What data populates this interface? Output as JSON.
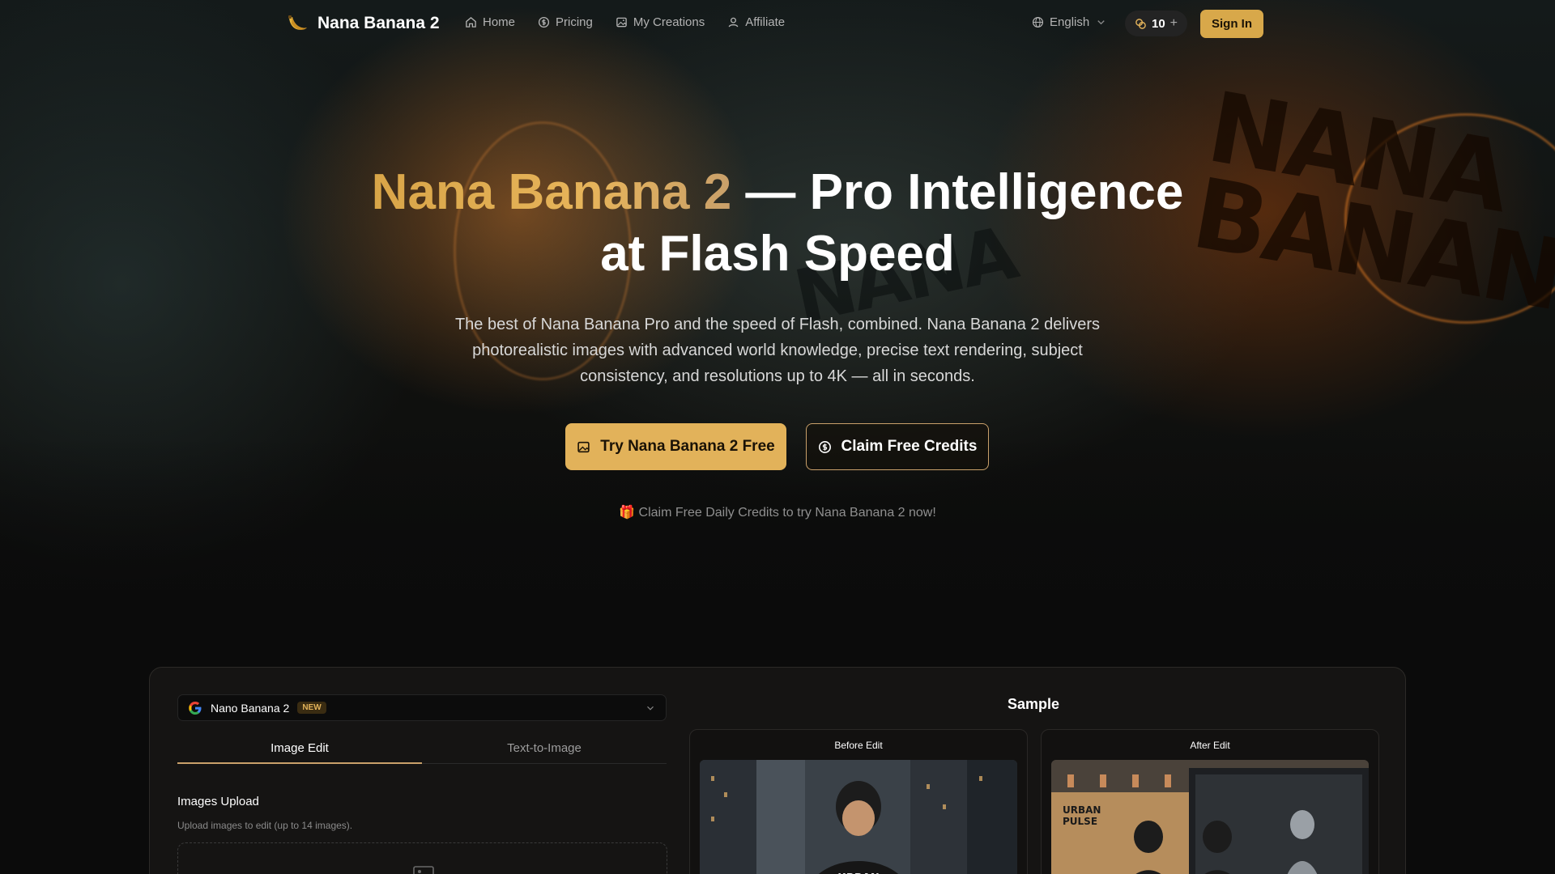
{
  "nav": {
    "brand": "Nana Banana 2",
    "links": [
      {
        "label": "Home",
        "icon": "home-icon"
      },
      {
        "label": "Pricing",
        "icon": "dollar-circle-icon"
      },
      {
        "label": "My Creations",
        "icon": "image-icon"
      },
      {
        "label": "Affiliate",
        "icon": "user-icon"
      }
    ],
    "language": "English",
    "credits": "10",
    "credits_plus": "+",
    "signin": "Sign In"
  },
  "hero": {
    "title_accent": "Nana Banana 2",
    "title_rest": " — Pro Intelligence",
    "title_line2": "at Flash Speed",
    "subtitle": "The best of Nana Banana Pro and the speed of Flash, combined. Nana Banana 2 delivers photorealistic images with advanced world knowledge, precise text rendering, subject consistency, and resolutions up to 4K — all in seconds.",
    "cta_primary": "Try Nana Banana 2 Free",
    "cta_secondary": "Claim Free Credits",
    "promo": "🎁 Claim Free Daily Credits to try Nana Banana 2 now!",
    "graffiti_right": "NANA BANANA",
    "graffiti_center": "NANA"
  },
  "generator": {
    "model": "Nano Banana 2",
    "model_badge": "NEW",
    "tabs": [
      "Image Edit",
      "Text-to-Image"
    ],
    "upload_label": "Images Upload",
    "upload_hint": "Upload images to edit (up to 14 images).",
    "sample_title": "Sample",
    "before_label": "Before Edit",
    "after_label": "After Edit"
  },
  "colors": {
    "accent": "#e2b25a",
    "background": "#0b0b0b"
  }
}
